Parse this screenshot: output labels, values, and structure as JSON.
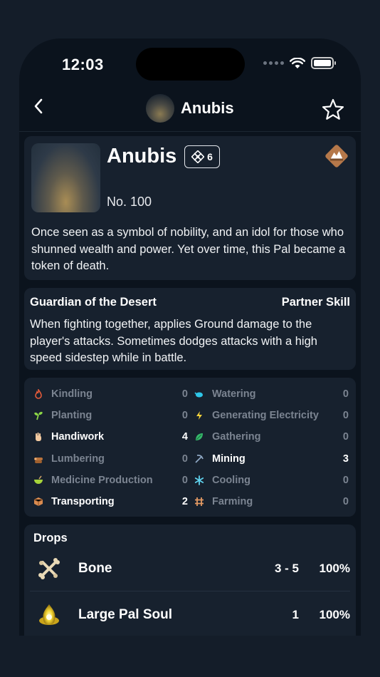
{
  "status_bar": {
    "time": "12:03"
  },
  "nav": {
    "title": "Anubis"
  },
  "pal": {
    "name": "Anubis",
    "work_badge_value": "6",
    "number": "No. 100",
    "description": "Once seen as a symbol of nobility, and an idol for those who shunned wealth and power. Yet over time, this Pal became a token of death.",
    "element_color": "#b5784a"
  },
  "partner_skill": {
    "name": "Guardian of the Desert",
    "label": "Partner Skill",
    "description": "When fighting together, applies Ground damage to the player's attacks. Sometimes dodges attacks with a high speed sidestep while in battle."
  },
  "work_suitability": {
    "left": [
      {
        "label": "Kindling",
        "value": "0",
        "icon": "flame-icon"
      },
      {
        "label": "Planting",
        "value": "0",
        "icon": "sprout-icon"
      },
      {
        "label": "Handiwork",
        "value": "4",
        "icon": "hand-icon"
      },
      {
        "label": "Lumbering",
        "value": "0",
        "icon": "log-icon"
      },
      {
        "label": "Medicine Production",
        "value": "0",
        "icon": "bowl-icon"
      },
      {
        "label": "Transporting",
        "value": "2",
        "icon": "box-icon"
      }
    ],
    "right": [
      {
        "label": "Watering",
        "value": "0",
        "icon": "watering-can-icon"
      },
      {
        "label": "Generating Electricity",
        "value": "0",
        "icon": "lightning-icon"
      },
      {
        "label": "Gathering",
        "value": "0",
        "icon": "leaf-icon"
      },
      {
        "label": "Mining",
        "value": "3",
        "icon": "pickaxe-icon"
      },
      {
        "label": "Cooling",
        "value": "0",
        "icon": "snowflake-icon"
      },
      {
        "label": "Farming",
        "value": "0",
        "icon": "ranch-icon"
      }
    ]
  },
  "drops": {
    "title": "Drops",
    "items": [
      {
        "name": "Bone",
        "quantity": "3 - 5",
        "rate": "100%",
        "icon": "bone-icon"
      },
      {
        "name": "Large Pal Soul",
        "quantity": "1",
        "rate": "100%",
        "icon": "pal-soul-icon"
      }
    ]
  }
}
